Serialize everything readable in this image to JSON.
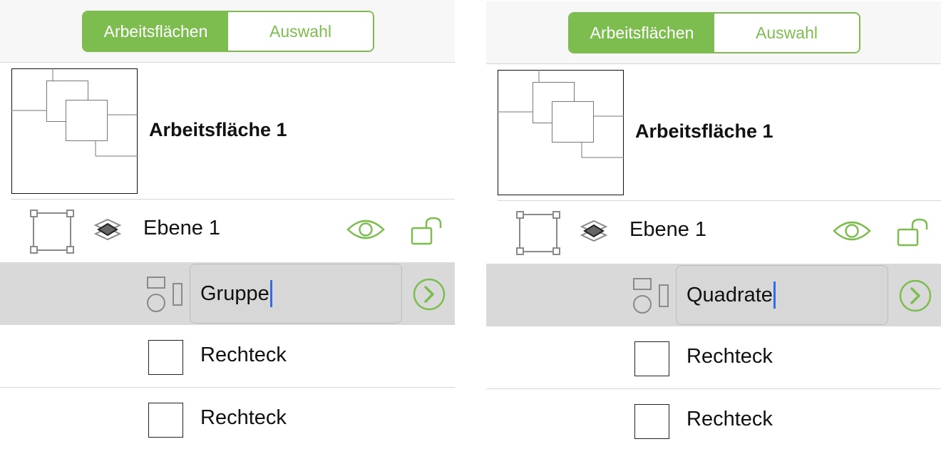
{
  "colors": {
    "accent": "#7dbd4f",
    "caret": "#2f6ce5",
    "selected_row": "#d9d9d9"
  },
  "panels": [
    {
      "segmented": {
        "artboards_label": "Arbeitsflächen",
        "selection_label": "Auswahl",
        "active": "artboards"
      },
      "artboard": {
        "name": "Arbeitsfläche 1"
      },
      "layer": {
        "name": "Ebene 1",
        "icons": [
          "bounding-box-icon",
          "layers-icon",
          "eye-icon",
          "unlock-icon"
        ]
      },
      "group": {
        "name": "Gruppe",
        "icons": [
          "shapes-group-icon",
          "chevron-right-circle-icon"
        ]
      },
      "items": [
        {
          "name": "Rechteck"
        },
        {
          "name": "Rechteck"
        }
      ]
    },
    {
      "segmented": {
        "artboards_label": "Arbeitsflächen",
        "selection_label": "Auswahl",
        "active": "artboards"
      },
      "artboard": {
        "name": "Arbeitsfläche 1"
      },
      "layer": {
        "name": "Ebene 1",
        "icons": [
          "bounding-box-icon",
          "layers-icon",
          "eye-icon",
          "unlock-icon"
        ]
      },
      "group": {
        "name": "Quadrate",
        "icons": [
          "shapes-group-icon",
          "chevron-right-circle-icon"
        ]
      },
      "items": [
        {
          "name": "Rechteck"
        },
        {
          "name": "Rechteck"
        }
      ]
    }
  ]
}
